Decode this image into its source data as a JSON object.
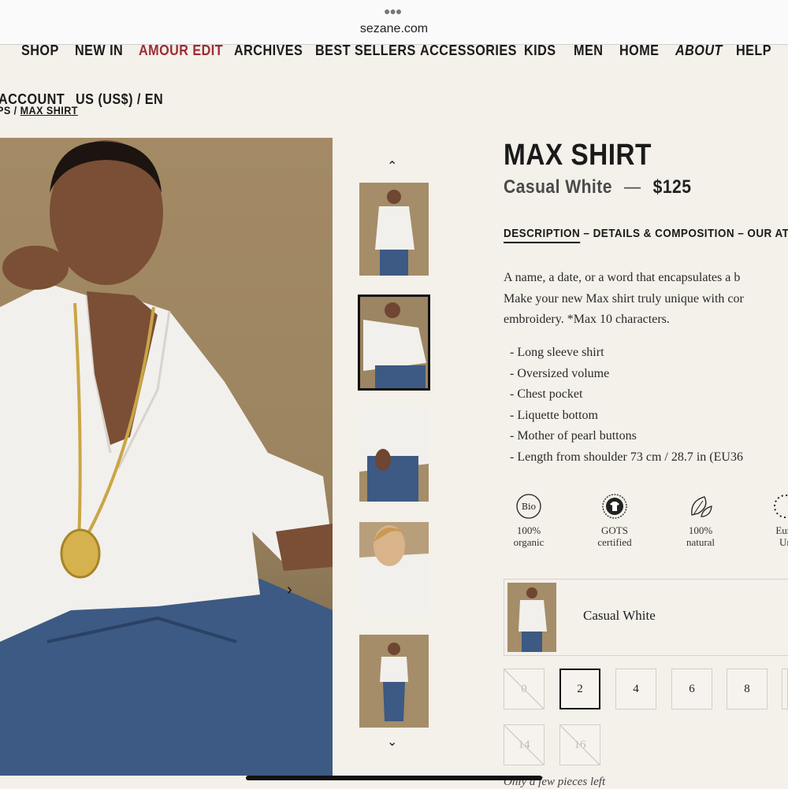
{
  "browser": {
    "url": "sezane.com"
  },
  "nav": {
    "items": [
      {
        "label": "SHOP"
      },
      {
        "label": "NEW IN"
      },
      {
        "label": "AMOUR EDIT"
      },
      {
        "label": "ARCHIVES"
      },
      {
        "label": "BEST SELLERS"
      },
      {
        "label": "ACCESSORIES"
      },
      {
        "label": "KIDS"
      },
      {
        "label": "MEN"
      },
      {
        "label": "HOME"
      },
      {
        "label": "ABOUT"
      },
      {
        "label": "HELP"
      }
    ],
    "account": "ACCOUNT",
    "locale": "US (US$) / EN"
  },
  "breadcrumb": {
    "prev": "PS",
    "separator": "/",
    "current": "MAX SHIRT"
  },
  "product": {
    "title": "MAX SHIRT",
    "color": "Casual White",
    "dash": "—",
    "price": "$125",
    "tabs": {
      "description": "DESCRIPTION",
      "details": "– DETAILS & COMPOSITION",
      "atelier": "– OUR ATELIE"
    },
    "description_lines": [
      "A name, a date, or a word that encapsulates a b",
      "Make your new Max shirt truly unique with cor",
      "embroidery. *Max 10 characters."
    ],
    "features": [
      "- Long sleeve shirt",
      "- Oversized volume",
      "- Chest pocket",
      "- Liquette bottom",
      "- Mother of pearl buttons",
      "- Length from shoulder 73 cm / 28.7 in (EU36"
    ],
    "badges": [
      {
        "icon": "bio-icon",
        "symbol": "Bio",
        "line1": "100%",
        "line2": "organic"
      },
      {
        "icon": "gots-icon",
        "line1": "GOTS",
        "line2": "certified"
      },
      {
        "icon": "leaf-icon",
        "line1": "100%",
        "line2": "natural"
      },
      {
        "icon": "eu-stars-icon",
        "line1": "Euro",
        "line2": "Un"
      }
    ],
    "selected_color": "Casual White",
    "sizes": [
      {
        "label": "0",
        "state": "disabled"
      },
      {
        "label": "2",
        "state": "selected"
      },
      {
        "label": "4",
        "state": "available"
      },
      {
        "label": "6",
        "state": "available"
      },
      {
        "label": "8",
        "state": "available"
      },
      {
        "label": "14",
        "state": "disabled"
      },
      {
        "label": "16",
        "state": "disabled"
      }
    ],
    "stock_note": "Only a few pieces left"
  },
  "gallery": {
    "up_arrow": "⌃",
    "down_arrow": "⌄",
    "next_arrow": "›",
    "active_thumb": 2
  },
  "colors": {
    "accent": "#9e2b33",
    "background": "#f4f0ea",
    "text": "#1a1a1a"
  }
}
